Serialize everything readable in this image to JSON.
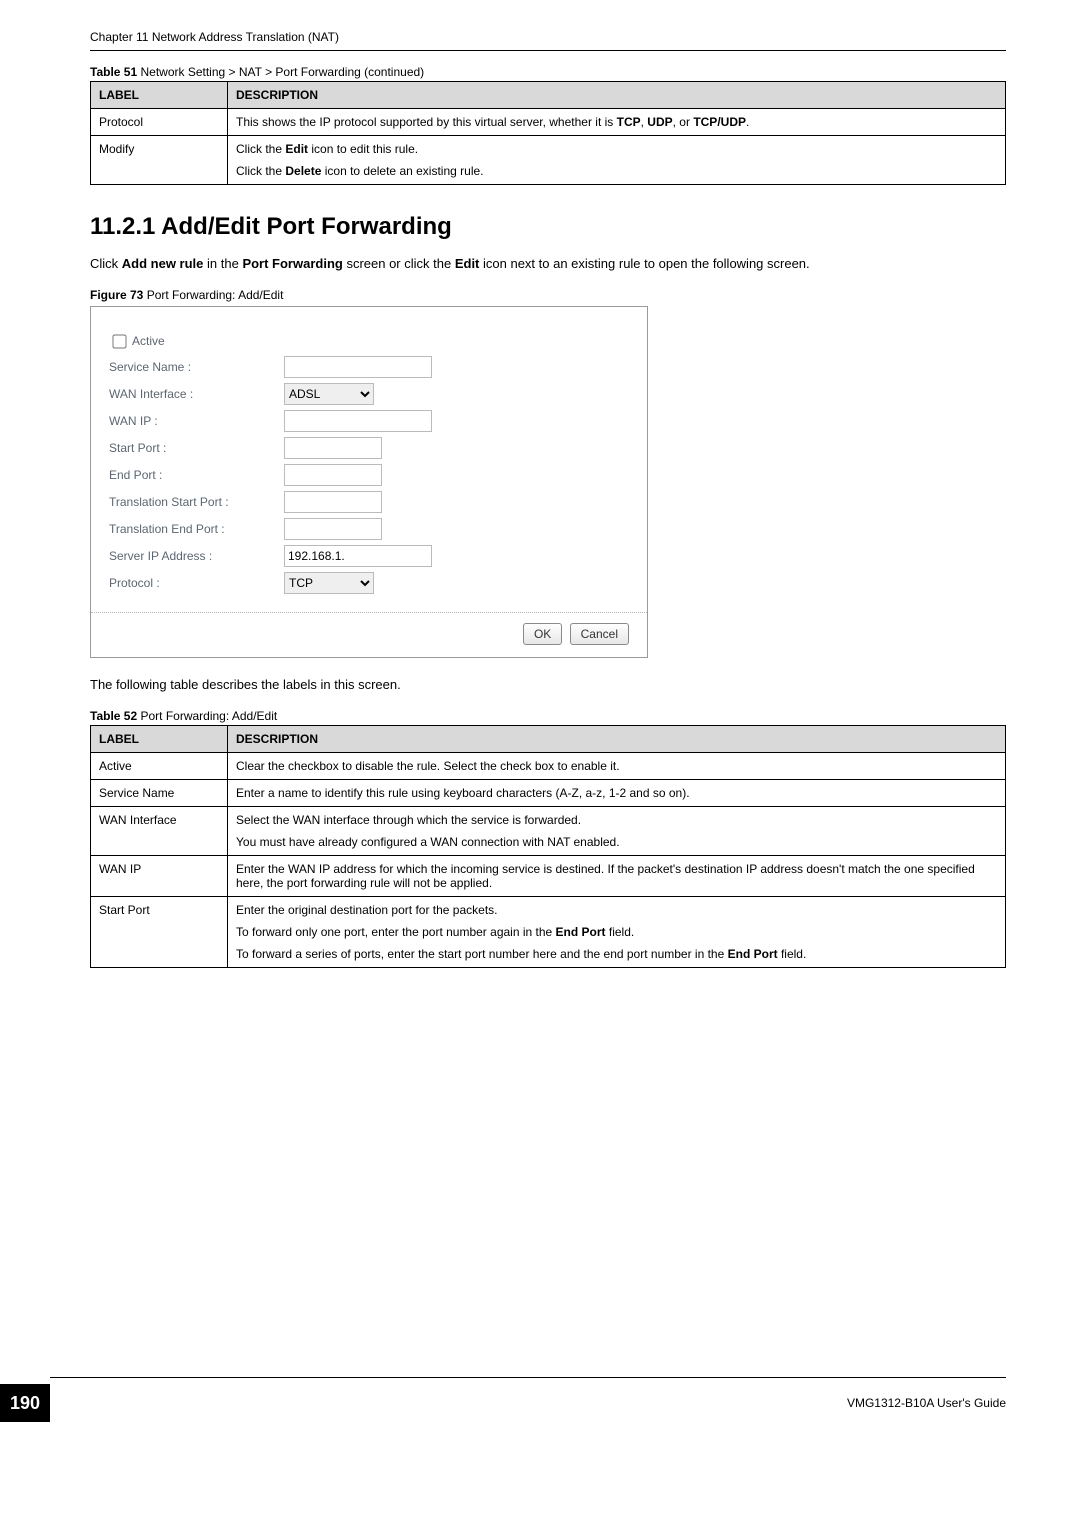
{
  "header": {
    "running_head": "Chapter 11 Network Address Translation (NAT)"
  },
  "table51": {
    "caption_bold": "Table 51",
    "caption_rest": "   Network Setting > NAT > Port Forwarding (continued)",
    "col_label": "LABEL",
    "col_desc": "DESCRIPTION",
    "rows": [
      {
        "label": "Protocol",
        "desc_pre": "This shows the IP protocol supported by this virtual server, whether it is ",
        "b1": "TCP",
        "sep1": ", ",
        "b2": "UDP",
        "sep2": ", or ",
        "b3": "TCP/UDP",
        "tail": "."
      },
      {
        "label": "Modify",
        "line1_pre": "Click the ",
        "line1_b": "Edit",
        "line1_post": " icon to edit this rule.",
        "line2_pre": "Click the ",
        "line2_b": "Delete",
        "line2_post": " icon to delete an existing rule."
      }
    ]
  },
  "section": {
    "heading": "11.2.1  Add/Edit Port Forwarding",
    "para_pre": "Click ",
    "para_b1": "Add new rule",
    "para_mid1": " in the ",
    "para_b2": "Port Forwarding",
    "para_mid2": " screen or click the ",
    "para_b3": "Edit",
    "para_post": " icon next to an existing rule to open the following screen."
  },
  "figure": {
    "caption_bold": "Figure 73",
    "caption_rest": "   Port Forwarding: Add/Edit"
  },
  "dialog": {
    "active_label": "Active",
    "rows": {
      "service_name": {
        "label": "Service Name :",
        "value": ""
      },
      "wan_interface": {
        "label": "WAN Interface :",
        "value": "ADSL"
      },
      "wan_ip": {
        "label": "WAN IP :",
        "value": ""
      },
      "start_port": {
        "label": "Start Port :",
        "value": ""
      },
      "end_port": {
        "label": "End Port :",
        "value": ""
      },
      "trans_start": {
        "label": "Translation Start Port :",
        "value": ""
      },
      "trans_end": {
        "label": "Translation End Port :",
        "value": ""
      },
      "server_ip": {
        "label": "Server IP Address :",
        "value": "192.168.1."
      },
      "protocol": {
        "label": "Protocol :",
        "value": "TCP"
      }
    },
    "buttons": {
      "ok": "OK",
      "cancel": "Cancel"
    }
  },
  "between_para": "The following table describes the labels in this screen.",
  "table52": {
    "caption_bold": "Table 52",
    "caption_rest": "   Port Forwarding: Add/Edit",
    "col_label": "LABEL",
    "col_desc": "DESCRIPTION",
    "rows": {
      "active": {
        "label": "Active",
        "desc": "Clear the checkbox to disable the rule. Select the check box to enable it."
      },
      "service_name": {
        "label": "Service Name",
        "desc": "Enter a name to identify this rule using keyboard characters (A-Z, a-z, 1-2 and so on)."
      },
      "wan_interface": {
        "label": "WAN Interface",
        "line1": "Select the WAN interface through which the service is forwarded.",
        "line2": "You must have already configured a WAN connection with NAT enabled."
      },
      "wan_ip": {
        "label": "WAN IP",
        "desc": "Enter the WAN IP address for which the incoming service is destined. If the packet's destination IP address doesn't match the one specified here, the port forwarding rule will not be applied."
      },
      "start_port": {
        "label": "Start Port",
        "line1": "Enter the original destination port for the packets.",
        "line2_pre": "To forward only one port, enter the port number again in the ",
        "line2_b": "End Port",
        "line2_post": " field.",
        "line3_pre": "To forward a series of ports, enter the start port number here and the end port number in the ",
        "line3_b": "End Port",
        "line3_post": " field."
      }
    }
  },
  "footer": {
    "page_number": "190",
    "guide": "VMG1312-B10A User's Guide"
  }
}
